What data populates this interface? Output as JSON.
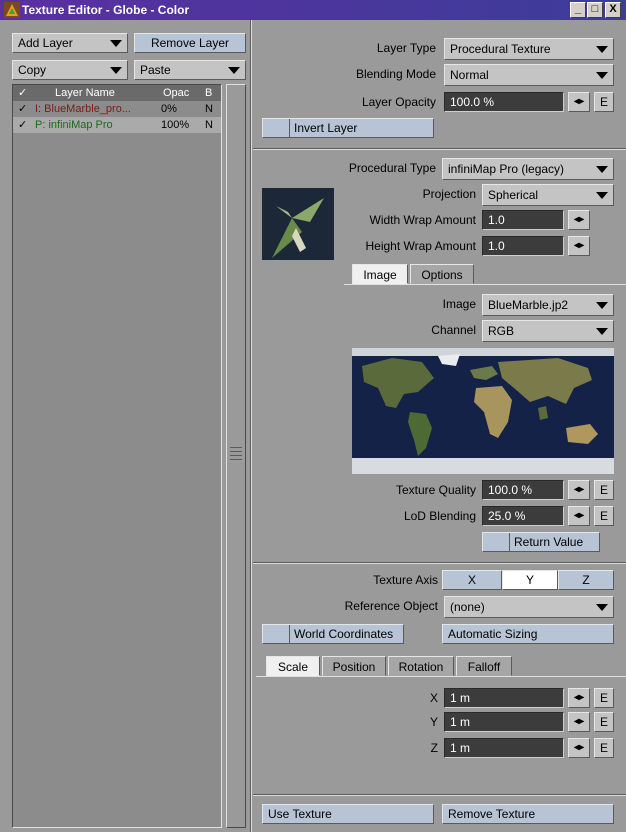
{
  "window": {
    "title": "Texture Editor - Globe - Color",
    "controls": [
      "_",
      "□",
      "X"
    ]
  },
  "left": {
    "add_layer": "Add Layer",
    "remove_layer": "Remove Layer",
    "copy": "Copy",
    "paste": "Paste",
    "columns": {
      "check": "✓",
      "name": "Layer Name",
      "opacity": "Opac",
      "blend": "B"
    },
    "layers": [
      {
        "check": "✓",
        "name": "I: BlueMarble_pro...",
        "opacity": "0%",
        "blend": "N",
        "color": "#7a1a1a"
      },
      {
        "check": "✓",
        "name": "P: infiniMap Pro",
        "opacity": "100%",
        "blend": "N",
        "color": "#1a6a1a"
      }
    ]
  },
  "layer": {
    "type_label": "Layer Type",
    "type_value": "Procedural Texture",
    "blend_label": "Blending Mode",
    "blend_value": "Normal",
    "opacity_label": "Layer Opacity",
    "opacity_value": "100.0 %",
    "invert": "Invert Layer"
  },
  "procedural": {
    "type_label": "Procedural Type",
    "type_value": "infiniMap Pro (legacy)",
    "projection_label": "Projection",
    "projection_value": "Spherical",
    "width_wrap_label": "Width Wrap Amount",
    "width_wrap_value": "1.0",
    "height_wrap_label": "Height Wrap Amount",
    "height_wrap_value": "1.0",
    "tabs": [
      "Image",
      "Options"
    ],
    "image_label": "Image",
    "image_value": "BlueMarble.jp2",
    "channel_label": "Channel",
    "channel_value": "RGB",
    "quality_label": "Texture Quality",
    "quality_value": "100.0 %",
    "lod_label": "LoD Blending",
    "lod_value": "25.0 %",
    "return_value": "Return Value"
  },
  "texture": {
    "axis_label": "Texture Axis",
    "axes": [
      "X",
      "Y",
      "Z"
    ],
    "selected_axis": "Y",
    "ref_label": "Reference Object",
    "ref_value": "(none)",
    "world_coords": "World Coordinates",
    "auto_sizing": "Automatic Sizing",
    "tabs": [
      "Scale",
      "Position",
      "Rotation",
      "Falloff"
    ],
    "x_label": "X",
    "x_value": "1 m",
    "y_label": "Y",
    "y_value": "1 m",
    "z_label": "Z",
    "z_value": "1 m",
    "e": "E",
    "arrows": "◂▸"
  },
  "footer": {
    "use_texture": "Use Texture",
    "remove_texture": "Remove Texture"
  }
}
